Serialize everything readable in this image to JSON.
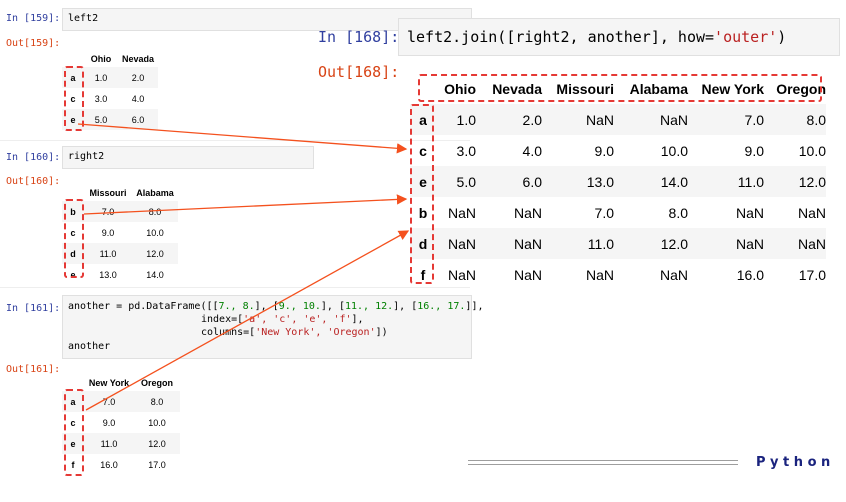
{
  "cells": {
    "c159": {
      "in": "In [159]:",
      "out": "Out[159]:",
      "code": "left2"
    },
    "c160": {
      "in": "In [160]:",
      "out": "Out[160]:",
      "code": "right2"
    },
    "c161": {
      "in": "In [161]:",
      "out": "Out[161]:",
      "line1_a": "another = pd.DataFrame([[",
      "line1_b": "7., 8.",
      "line1_c": "], [",
      "line1_d": "9., 10.",
      "line1_e": "], [",
      "line1_f": "11., 12.",
      "line1_g": "], [",
      "line1_h": "16., 17.",
      "line1_i": "]],",
      "line2_a": "index=[",
      "line2_b": "'a', 'c', 'e', 'f'",
      "line2_c": "],",
      "line3_a": "columns=[",
      "line3_b": "'New York', 'Oregon'",
      "line3_c": "])",
      "line4": "another"
    },
    "c168": {
      "in": "In [168]:",
      "out": "Out[168]:",
      "code_a": "left2.join([right2, another], how=",
      "code_b": "'outer'",
      "code_c": ")"
    }
  },
  "left2": {
    "columns": [
      "Ohio",
      "Nevada"
    ],
    "rows": [
      {
        "idx": "a",
        "v": [
          "1.0",
          "2.0"
        ]
      },
      {
        "idx": "c",
        "v": [
          "3.0",
          "4.0"
        ]
      },
      {
        "idx": "e",
        "v": [
          "5.0",
          "6.0"
        ]
      }
    ]
  },
  "right2": {
    "columns": [
      "Missouri",
      "Alabama"
    ],
    "rows": [
      {
        "idx": "b",
        "v": [
          "7.0",
          "8.0"
        ]
      },
      {
        "idx": "c",
        "v": [
          "9.0",
          "10.0"
        ]
      },
      {
        "idx": "d",
        "v": [
          "11.0",
          "12.0"
        ]
      },
      {
        "idx": "e",
        "v": [
          "13.0",
          "14.0"
        ]
      }
    ]
  },
  "another": {
    "columns": [
      "New York",
      "Oregon"
    ],
    "rows": [
      {
        "idx": "a",
        "v": [
          "7.0",
          "8.0"
        ]
      },
      {
        "idx": "c",
        "v": [
          "9.0",
          "10.0"
        ]
      },
      {
        "idx": "e",
        "v": [
          "11.0",
          "12.0"
        ]
      },
      {
        "idx": "f",
        "v": [
          "16.0",
          "17.0"
        ]
      }
    ]
  },
  "joined": {
    "columns": [
      "Ohio",
      "Nevada",
      "Missouri",
      "Alabama",
      "New York",
      "Oregon"
    ],
    "rows": [
      {
        "idx": "a",
        "v": [
          "1.0",
          "2.0",
          "NaN",
          "NaN",
          "7.0",
          "8.0"
        ]
      },
      {
        "idx": "c",
        "v": [
          "3.0",
          "4.0",
          "9.0",
          "10.0",
          "9.0",
          "10.0"
        ]
      },
      {
        "idx": "e",
        "v": [
          "5.0",
          "6.0",
          "13.0",
          "14.0",
          "11.0",
          "12.0"
        ]
      },
      {
        "idx": "b",
        "v": [
          "NaN",
          "NaN",
          "7.0",
          "8.0",
          "NaN",
          "NaN"
        ]
      },
      {
        "idx": "d",
        "v": [
          "NaN",
          "NaN",
          "11.0",
          "12.0",
          "NaN",
          "NaN"
        ]
      },
      {
        "idx": "f",
        "v": [
          "NaN",
          "NaN",
          "NaN",
          "NaN",
          "16.0",
          "17.0"
        ]
      }
    ]
  },
  "footer": {
    "brand": "P y t h o n"
  },
  "colors": {
    "annotation": "#e53935",
    "arrow": "#f4511e",
    "footer_line": "#9e9e9e"
  }
}
